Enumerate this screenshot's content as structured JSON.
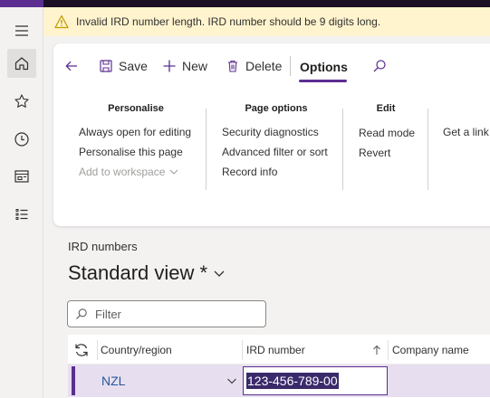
{
  "notification": {
    "message": "Invalid IRD number length. IRD number should be 9 digits long."
  },
  "nav_rail": [
    {
      "name": "hamburger",
      "icon": "hamburger-menu-icon"
    },
    {
      "name": "home",
      "icon": "home-icon"
    },
    {
      "name": "favorites",
      "icon": "star-icon"
    },
    {
      "name": "recent",
      "icon": "clock-icon"
    },
    {
      "name": "workspaces",
      "icon": "workspace-icon"
    },
    {
      "name": "modules",
      "icon": "list-icon"
    }
  ],
  "toolbar": {
    "save_label": "Save",
    "new_label": "New",
    "delete_label": "Delete",
    "options_tab": "Options"
  },
  "action_groups": {
    "personalise": {
      "title": "Personalise",
      "items": [
        "Always open for editing",
        "Personalise this page",
        "Add to workspace"
      ]
    },
    "page_options": {
      "title": "Page options",
      "items": [
        "Security diagnostics",
        "Advanced filter or sort",
        "Record info"
      ]
    },
    "edit": {
      "title": "Edit",
      "items": [
        "Read mode",
        "Revert"
      ]
    },
    "share": {
      "items": [
        "Get a link"
      ]
    }
  },
  "page": {
    "breadcrumb": "IRD numbers",
    "view_title": "Standard view *"
  },
  "filter": {
    "placeholder": "Filter"
  },
  "grid": {
    "columns": [
      "Country/region",
      "IRD number",
      "Company name"
    ],
    "rows": [
      {
        "country": "NZL",
        "ird_number": "123-456-789-00",
        "company": ""
      }
    ]
  },
  "colors": {
    "accent": "#5c2e91",
    "warning_bg": "#fff4ce",
    "warning_icon": "#c19c00",
    "selected_row": "#e7dff0"
  }
}
